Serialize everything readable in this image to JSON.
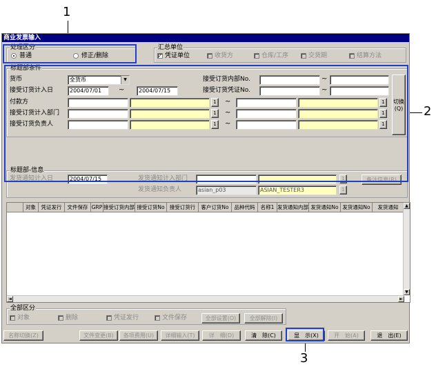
{
  "window": {
    "title": "商业发票输入"
  },
  "processing": {
    "legend": "处理区分",
    "options": [
      "普通",
      "修正/删除"
    ],
    "selected": 0
  },
  "summary_unit": {
    "legend": "汇总单位",
    "items": [
      {
        "label": "凭证单位",
        "checked": true,
        "enabled": true
      },
      {
        "label": "收货方",
        "checked": false,
        "enabled": false
      },
      {
        "label": "仓库/工序",
        "checked": false,
        "enabled": false
      },
      {
        "label": "交货期",
        "checked": false,
        "enabled": false
      },
      {
        "label": "结算方法",
        "checked": false,
        "enabled": false
      }
    ]
  },
  "conditions": {
    "legend": "标题部条件",
    "currency_label": "货币",
    "currency_value": "全货币",
    "recv_date_label": "接受订货计入日",
    "recv_date_from": "2004/07/01",
    "recv_date_to": "2004/07/15",
    "payer_label": "付款方",
    "recv_dept_label": "接受订货计入部门",
    "recv_person_label": "接受订货负责人",
    "inner_no_label": "接受订货内部No.",
    "voucher_no_label": "接受订货凭证No.",
    "switch_label": "切换",
    "switch_key": "(Q)",
    "lookup_glyph": "1",
    "tilde": "~"
  },
  "header_info": {
    "legend": "标题部-信息",
    "notice_date_label": "发货通知计入日",
    "notice_date_value": "2004/07/15",
    "notice_dept_label": "发货通知计入部门",
    "notice_person_label": "发货通知负责人",
    "person_code": "asian_p03",
    "person_name": "ASIAN_TESTER3",
    "remark_button": "备注信息(R)"
  },
  "grid": {
    "columns": [
      "",
      "对象",
      "凭证发行",
      "文件保存",
      "GRP",
      "接受订货内部",
      "接受订货No",
      "接受订货行",
      "客户订货No",
      "品种代码",
      "名称1",
      "发货通知内部",
      "发货通知No",
      "发货通知No",
      "发货通知"
    ],
    "scroll_up": "▲",
    "scroll_down": "▼",
    "scroll_left": "◄",
    "scroll_right": "►"
  },
  "all_section": {
    "legend": "全部区分",
    "checks": [
      "对象",
      "删除",
      "凭证发行",
      "文件保存"
    ],
    "set_all": "全部设置(O)",
    "clear_all": "全部解除(I)"
  },
  "footer": {
    "buttons": [
      "名称切换(Z)",
      "文件变更(B)",
      "各项费用(U)",
      "详细输入(T)",
      "详　细(D)",
      "清　除(C)",
      "显　示(X)",
      "开　始(A)",
      "退　出(E)"
    ]
  },
  "callouts": [
    "1",
    "2",
    "3"
  ]
}
